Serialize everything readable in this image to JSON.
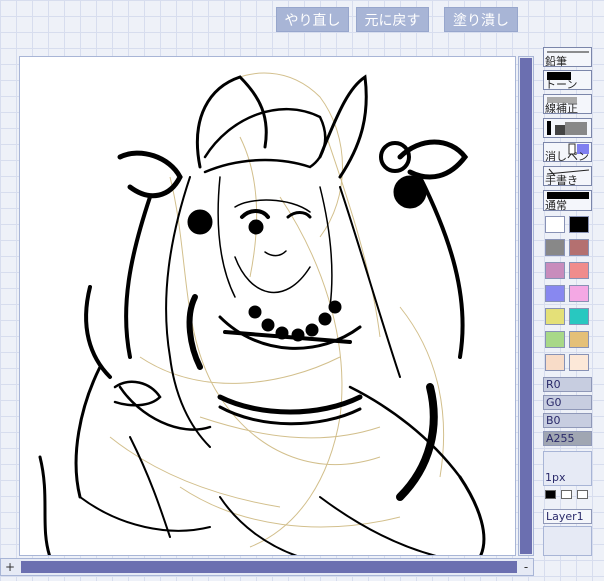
{
  "toolbar": {
    "redo": "やり直し",
    "undo": "元に戻す",
    "fill": "塗り潰し"
  },
  "tools": {
    "pencil": "鉛筆",
    "tone": "トーン",
    "blur": "線補正",
    "eraser": "消しペン",
    "hand": "手書き",
    "normal": "通常"
  },
  "palette": [
    "#ffffff",
    "#000000",
    "#888888",
    "#b47070",
    "#c88cbc",
    "#f08c8c",
    "#8888f0",
    "#f4a8e4",
    "#e4e078",
    "#28c8c0",
    "#a8d888",
    "#e4c078",
    "#f8dcc8",
    "#fce8d8"
  ],
  "color": {
    "r": "R0",
    "g": "G0",
    "b": "B0",
    "a": "A255"
  },
  "brush_size": "1px",
  "layer": "Layer1",
  "scroll": {
    "plus": "+",
    "minus": "-"
  }
}
